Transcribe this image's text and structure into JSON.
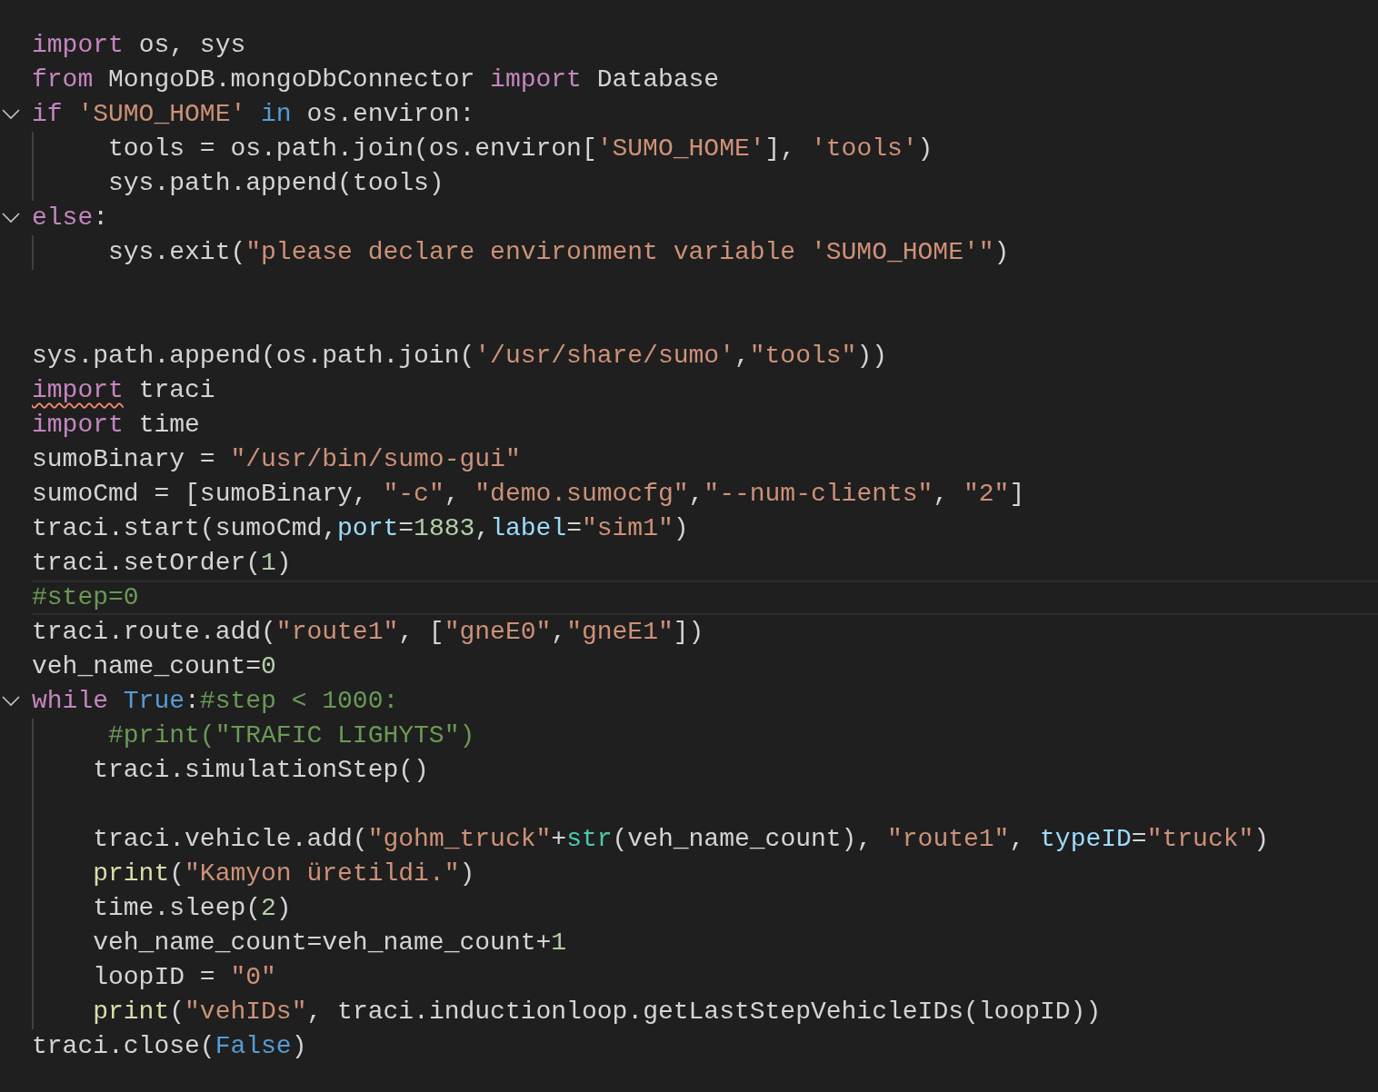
{
  "lines": [
    {
      "kind": "code",
      "tokens": [
        {
          "t": "import",
          "kind": "kw"
        },
        {
          "t": " os, sys",
          "kind": "txt"
        }
      ]
    },
    {
      "kind": "code",
      "tokens": [
        {
          "t": "from",
          "kind": "kw"
        },
        {
          "t": " MongoDB.mongoDbConnector ",
          "kind": "txt"
        },
        {
          "t": "import",
          "kind": "kw"
        },
        {
          "t": " Database",
          "kind": "txt"
        }
      ]
    },
    {
      "kind": "code",
      "expanded": true,
      "tokens": [
        {
          "t": "if",
          "kind": "kw"
        },
        {
          "t": " 'SUMO_HOME'",
          "kind": "str"
        },
        {
          "t": " in",
          "kind": "const"
        },
        {
          "t": " os.environ:",
          "kind": "txt"
        }
      ],
      "children": [
        {
          "kind": "code",
          "tokens": [
            {
              "t": "     tools = os.path.join(os.environ[",
              "kind": "txt"
            },
            {
              "t": "'SUMO_HOME'",
              "kind": "str"
            },
            {
              "t": "], ",
              "kind": "txt"
            },
            {
              "t": "'tools'",
              "kind": "str"
            },
            {
              "t": ")",
              "kind": "txt"
            }
          ]
        },
        {
          "kind": "code",
          "tokens": [
            {
              "t": "     sys.path.append(tools)",
              "kind": "txt"
            }
          ]
        }
      ]
    },
    {
      "kind": "code",
      "expanded": true,
      "tokens": [
        {
          "t": "else",
          "kind": "kw"
        },
        {
          "t": ":",
          "kind": "txt"
        }
      ],
      "children": [
        {
          "kind": "code",
          "tokens": [
            {
              "t": "     sys.exit(",
              "kind": "txt"
            },
            {
              "t": "\"please declare environment variable 'SUMO_HOME'\"",
              "kind": "str"
            },
            {
              "t": ")",
              "kind": "txt"
            }
          ]
        }
      ]
    },
    {
      "kind": "blank"
    },
    {
      "kind": "blank"
    },
    {
      "kind": "code",
      "tokens": [
        {
          "t": "sys.path.append(os.path.join(",
          "kind": "txt"
        },
        {
          "t": "'/usr/share/sumo'",
          "kind": "str"
        },
        {
          "t": ",",
          "kind": "txt"
        },
        {
          "t": "\"tools\"",
          "kind": "str"
        },
        {
          "t": "))",
          "kind": "txt"
        }
      ]
    },
    {
      "kind": "code",
      "tokens": [
        {
          "t": "import",
          "kind": "kw",
          "warning": true
        },
        {
          "t": " traci",
          "kind": "txt"
        }
      ]
    },
    {
      "kind": "code",
      "tokens": [
        {
          "t": "import",
          "kind": "kw"
        },
        {
          "t": " time",
          "kind": "txt"
        }
      ]
    },
    {
      "kind": "code",
      "tokens": [
        {
          "t": "sumoBinary = ",
          "kind": "txt"
        },
        {
          "t": "\"/usr/bin/sumo-gui\"",
          "kind": "str"
        }
      ]
    },
    {
      "kind": "code",
      "tokens": [
        {
          "t": "sumoCmd = [sumoBinary, ",
          "kind": "txt"
        },
        {
          "t": "\"-c\"",
          "kind": "str"
        },
        {
          "t": ", ",
          "kind": "txt"
        },
        {
          "t": "\"demo.sumocfg\"",
          "kind": "str"
        },
        {
          "t": ",",
          "kind": "txt"
        },
        {
          "t": "\"--num-clients\"",
          "kind": "str"
        },
        {
          "t": ", ",
          "kind": "txt"
        },
        {
          "t": "\"2\"",
          "kind": "str"
        },
        {
          "t": "]",
          "kind": "txt"
        }
      ]
    },
    {
      "kind": "code",
      "tokens": [
        {
          "t": "traci.start(sumoCmd,",
          "kind": "txt"
        },
        {
          "t": "port",
          "kind": "param"
        },
        {
          "t": "=",
          "kind": "txt"
        },
        {
          "t": "1883",
          "kind": "num"
        },
        {
          "t": ",",
          "kind": "txt"
        },
        {
          "t": "label",
          "kind": "param"
        },
        {
          "t": "=",
          "kind": "txt"
        },
        {
          "t": "\"sim1\"",
          "kind": "str"
        },
        {
          "t": ")",
          "kind": "txt"
        }
      ]
    },
    {
      "kind": "code",
      "tokens": [
        {
          "t": "traci.setOrder(",
          "kind": "txt"
        },
        {
          "t": "1",
          "kind": "num"
        },
        {
          "t": ")",
          "kind": "txt"
        }
      ]
    },
    {
      "kind": "code",
      "current": true,
      "tokens": [
        {
          "t": "#step=0",
          "kind": "cmt"
        }
      ]
    },
    {
      "kind": "code",
      "tokens": [
        {
          "t": "traci.route.add(",
          "kind": "txt"
        },
        {
          "t": "\"route1\"",
          "kind": "str"
        },
        {
          "t": ", [",
          "kind": "txt"
        },
        {
          "t": "\"gneE0\"",
          "kind": "str"
        },
        {
          "t": ",",
          "kind": "txt"
        },
        {
          "t": "\"gneE1\"",
          "kind": "str"
        },
        {
          "t": "])",
          "kind": "txt"
        }
      ]
    },
    {
      "kind": "code",
      "tokens": [
        {
          "t": "veh_name_count=",
          "kind": "txt"
        },
        {
          "t": "0",
          "kind": "num"
        }
      ]
    },
    {
      "kind": "code",
      "expanded": true,
      "tokens": [
        {
          "t": "while",
          "kind": "kw"
        },
        {
          "t": " True",
          "kind": "const"
        },
        {
          "t": ":",
          "kind": "txt"
        },
        {
          "t": "#step < 1000:",
          "kind": "cmt"
        }
      ],
      "children": [
        {
          "kind": "code",
          "tokens": [
            {
              "t": "     #print(\"TRAFIC LIGHYTS\")",
              "kind": "cmt"
            }
          ]
        },
        {
          "kind": "code",
          "tokens": [
            {
              "t": "    traci.simulationStep()",
              "kind": "txt"
            }
          ]
        },
        {
          "kind": "blank"
        },
        {
          "kind": "code",
          "tokens": [
            {
              "t": "    traci.vehicle.add(",
              "kind": "txt"
            },
            {
              "t": "\"gohm_truck\"",
              "kind": "str"
            },
            {
              "t": "+",
              "kind": "txt"
            },
            {
              "t": "str",
              "kind": "type"
            },
            {
              "t": "(veh_name_count), ",
              "kind": "txt"
            },
            {
              "t": "\"route1\"",
              "kind": "str"
            },
            {
              "t": ", ",
              "kind": "txt"
            },
            {
              "t": "typeID",
              "kind": "param"
            },
            {
              "t": "=",
              "kind": "txt"
            },
            {
              "t": "\"truck\"",
              "kind": "str"
            },
            {
              "t": ")",
              "kind": "txt"
            }
          ]
        },
        {
          "kind": "code",
          "tokens": [
            {
              "t": "    print",
              "kind": "fn"
            },
            {
              "t": "(",
              "kind": "txt"
            },
            {
              "t": "\"Kamyon üretildi.\"",
              "kind": "str"
            },
            {
              "t": ")",
              "kind": "txt"
            }
          ]
        },
        {
          "kind": "code",
          "tokens": [
            {
              "t": "    time.sleep(",
              "kind": "txt"
            },
            {
              "t": "2",
              "kind": "num"
            },
            {
              "t": ")",
              "kind": "txt"
            }
          ]
        },
        {
          "kind": "code",
          "tokens": [
            {
              "t": "    veh_name_count=veh_name_count+",
              "kind": "txt"
            },
            {
              "t": "1",
              "kind": "num"
            }
          ]
        },
        {
          "kind": "code",
          "tokens": [
            {
              "t": "    loopID = ",
              "kind": "txt"
            },
            {
              "t": "\"0\"",
              "kind": "str"
            }
          ]
        },
        {
          "kind": "code",
          "tokens": [
            {
              "t": "    print",
              "kind": "fn"
            },
            {
              "t": "(",
              "kind": "txt"
            },
            {
              "t": "\"vehIDs\"",
              "kind": "str"
            },
            {
              "t": ", traci.inductionloop.getLastStepVehicleIDs(loopID))",
              "kind": "txt"
            }
          ]
        }
      ]
    },
    {
      "kind": "code",
      "tokens": [
        {
          "t": "traci.close(",
          "kind": "txt"
        },
        {
          "t": "False",
          "kind": "const"
        },
        {
          "t": ")",
          "kind": "txt"
        }
      ]
    }
  ]
}
